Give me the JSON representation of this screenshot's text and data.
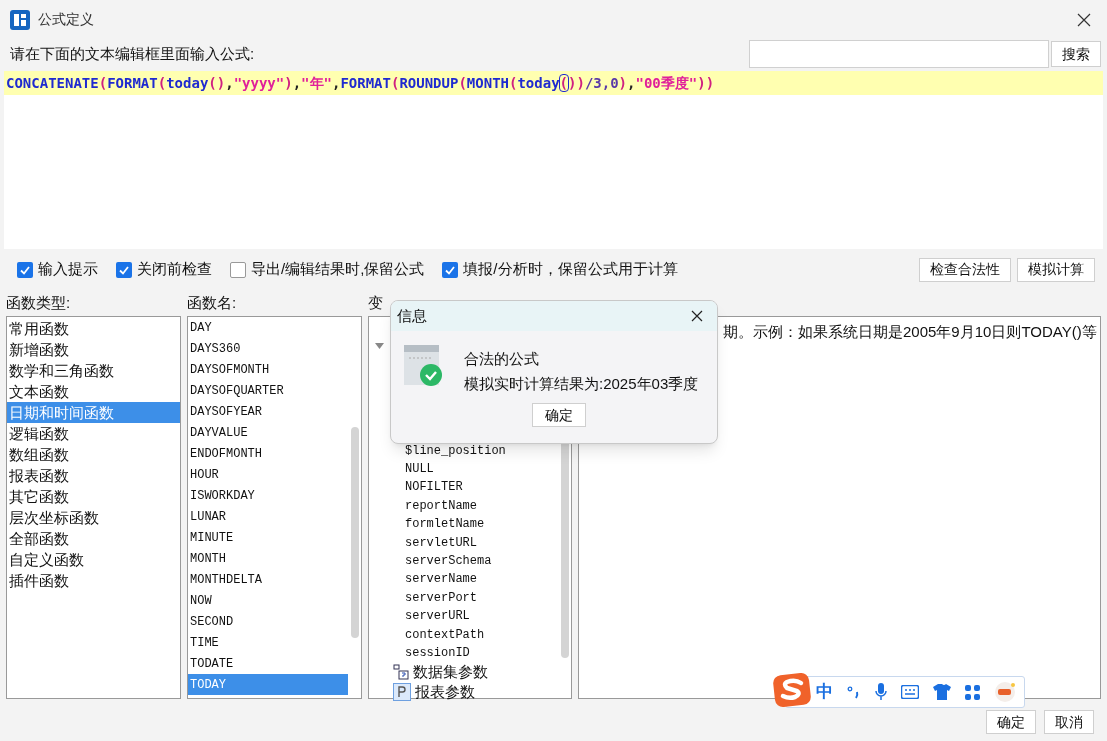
{
  "window": {
    "title": "公式定义"
  },
  "prompt": "请在下面的文本编辑框里面输入公式:",
  "search": {
    "button": "搜索"
  },
  "formula": [
    {
      "kind": "func",
      "text": "CONCATENATE"
    },
    {
      "kind": "paren",
      "text": "("
    },
    {
      "kind": "func",
      "text": "FORMAT"
    },
    {
      "kind": "paren",
      "text": "("
    },
    {
      "kind": "func",
      "text": "today"
    },
    {
      "kind": "paren",
      "text": "()"
    },
    {
      "kind": "plain",
      "text": ","
    },
    {
      "kind": "string",
      "text": "\"yyyy\""
    },
    {
      "kind": "paren",
      "text": ")"
    },
    {
      "kind": "plain",
      "text": ","
    },
    {
      "kind": "string",
      "text": "\"年\""
    },
    {
      "kind": "plain",
      "text": ","
    },
    {
      "kind": "func",
      "text": "FORMAT"
    },
    {
      "kind": "paren",
      "text": "("
    },
    {
      "kind": "func",
      "text": "ROUNDUP"
    },
    {
      "kind": "paren",
      "text": "("
    },
    {
      "kind": "func",
      "text": "MONTH"
    },
    {
      "kind": "paren",
      "text": "("
    },
    {
      "kind": "func",
      "text": "today"
    },
    {
      "kind": "cursor",
      "text": "("
    },
    {
      "kind": "paren",
      "text": "))"
    },
    {
      "kind": "number",
      "text": "/3,0"
    },
    {
      "kind": "paren",
      "text": ")"
    },
    {
      "kind": "plain",
      "text": ","
    },
    {
      "kind": "string",
      "text": "\"00季度\""
    },
    {
      "kind": "paren",
      "text": "))"
    }
  ],
  "options": [
    {
      "label": "输入提示",
      "checked": true
    },
    {
      "label": "关闭前检查",
      "checked": true
    },
    {
      "label": "导出/编辑结果时,保留公式",
      "checked": false
    },
    {
      "label": "填报/分析时，保留公式用于计算",
      "checked": true
    }
  ],
  "actions": [
    "检查合法性",
    "模拟计算"
  ],
  "function_types": {
    "title": "函数类型:",
    "items": [
      {
        "label": "常用函数",
        "selected": false
      },
      {
        "label": "新增函数",
        "selected": false
      },
      {
        "label": "数学和三角函数",
        "selected": false
      },
      {
        "label": "文本函数",
        "selected": false
      },
      {
        "label": "日期和时间函数",
        "selected": true
      },
      {
        "label": "逻辑函数",
        "selected": false
      },
      {
        "label": "数组函数",
        "selected": false
      },
      {
        "label": "报表函数",
        "selected": false
      },
      {
        "label": "其它函数",
        "selected": false
      },
      {
        "label": "层次坐标函数",
        "selected": false
      },
      {
        "label": "全部函数",
        "selected": false
      },
      {
        "label": "自定义函数",
        "selected": false
      },
      {
        "label": "插件函数",
        "selected": false
      }
    ]
  },
  "function_names": {
    "title": "函数名:",
    "items": [
      {
        "label": "DAY",
        "selected": false
      },
      {
        "label": "DAYS360",
        "selected": false
      },
      {
        "label": "DAYSOFMONTH",
        "selected": false
      },
      {
        "label": "DAYSOFQUARTER",
        "selected": false
      },
      {
        "label": "DAYSOFYEAR",
        "selected": false
      },
      {
        "label": "DAYVALUE",
        "selected": false
      },
      {
        "label": "ENDOFMONTH",
        "selected": false
      },
      {
        "label": "HOUR",
        "selected": false
      },
      {
        "label": "ISWORKDAY",
        "selected": false
      },
      {
        "label": "LUNAR",
        "selected": false
      },
      {
        "label": "MINUTE",
        "selected": false
      },
      {
        "label": "MONTH",
        "selected": false
      },
      {
        "label": "MONTHDELTA",
        "selected": false
      },
      {
        "label": "NOW",
        "selected": false
      },
      {
        "label": "SECOND",
        "selected": false
      },
      {
        "label": "TIME",
        "selected": false
      },
      {
        "label": "TODATE",
        "selected": false
      },
      {
        "label": "TODAY",
        "selected": true
      }
    ]
  },
  "variables": {
    "title": "变",
    "tree": [
      {
        "expanded": true,
        "children": [
          {
            "label": "$line_position"
          },
          {
            "label": "NULL"
          },
          {
            "label": "NOFILTER"
          },
          {
            "label": "reportName"
          },
          {
            "label": "formletName"
          },
          {
            "label": "servletURL"
          },
          {
            "label": "serverSchema"
          },
          {
            "label": "serverName"
          },
          {
            "label": "serverPort"
          },
          {
            "label": "serverURL"
          },
          {
            "label": "contextPath"
          },
          {
            "label": "sessionID"
          }
        ]
      },
      {
        "kind": "dataset",
        "label": "数据集参数"
      },
      {
        "kind": "report",
        "label": "报表参数"
      }
    ]
  },
  "description": "期。示例：如果系统日期是2005年9月10日则TODAY()等",
  "dialog": {
    "title": "信息",
    "heading": "合法的公式",
    "message": "模拟实时计算结果为:2025年03季度",
    "button": "确定"
  },
  "ime": {
    "mode": "中"
  },
  "footer": [
    "确定",
    "取消"
  ]
}
